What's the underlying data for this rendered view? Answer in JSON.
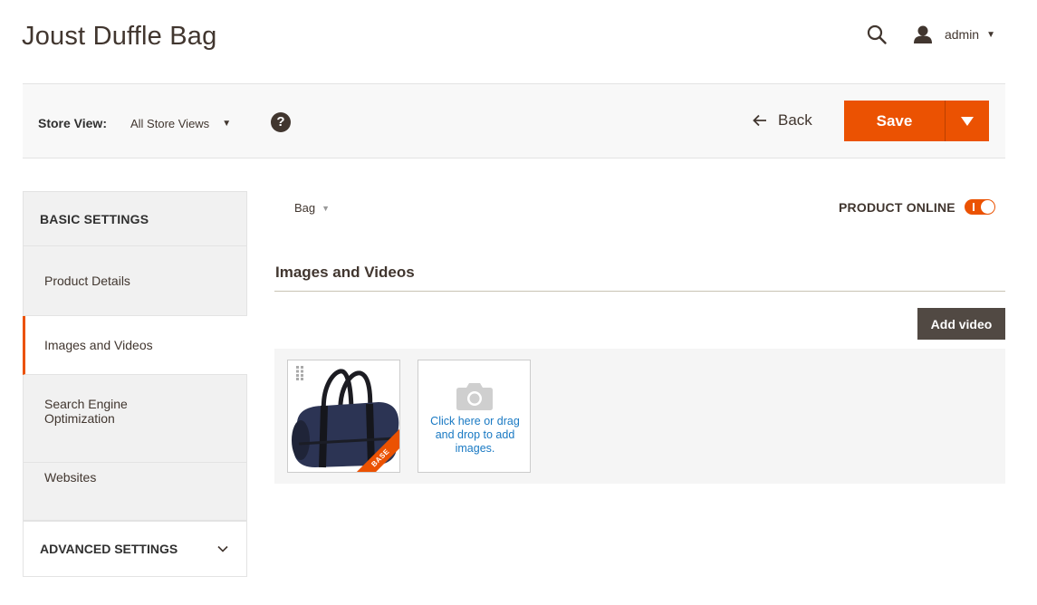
{
  "header": {
    "title": "Joust Duffle Bag",
    "user_name": "admin"
  },
  "toolbar": {
    "store_view_label": "Store View:",
    "store_view_value": "All Store Views",
    "back_label": "Back",
    "save_label": "Save"
  },
  "sidebar": {
    "basic_title": "BASIC SETTINGS",
    "items": [
      {
        "label": "Product Details",
        "active": false
      },
      {
        "label": "Images and Videos",
        "active": true
      },
      {
        "label": "Search Engine Optimization",
        "active": false
      },
      {
        "label": "Websites",
        "active": false
      }
    ],
    "advanced_title": "ADVANCED SETTINGS"
  },
  "main": {
    "attribute_set": "Bag",
    "product_online_label": "PRODUCT ONLINE",
    "product_online": true,
    "section_title": "Images and Videos",
    "add_video_label": "Add video",
    "base_badge": "BASE",
    "upload_text": "Click here or drag and drop to add images."
  },
  "colors": {
    "accent": "#eb5202",
    "dark_button": "#514943",
    "link": "#1979c3"
  },
  "icons": [
    "search-icon",
    "user-icon",
    "help-icon",
    "back-arrow-icon",
    "chevron-down-icon",
    "drag-handle-icon",
    "camera-icon"
  ]
}
